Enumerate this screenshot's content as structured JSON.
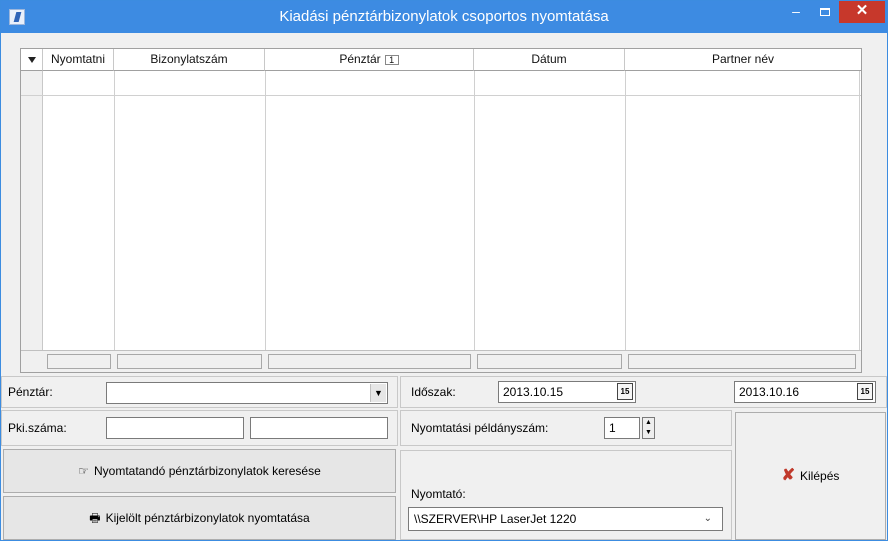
{
  "window": {
    "title": "Kiadási pénztárbizonylatok csoportos nyomtatása",
    "minimize": "–",
    "close": "✕"
  },
  "grid": {
    "columns": [
      "Nyomtatni",
      "Bizonylatszám",
      "Pénztár",
      "Dátum",
      "Partner név"
    ],
    "sort_badge": "1"
  },
  "filters": {
    "penztar_label": "Pénztár:",
    "penztar_value": "",
    "idoszak_label": "Időszak:",
    "date_from": "2013.10.15",
    "date_to": "2013.10.16",
    "calendar_glyph": "15",
    "pki_label": "Pki.száma:",
    "pki_from": "",
    "pki_to": "",
    "copies_label": "Nyomtatási példányszám:",
    "copies_value": "1",
    "printer_label": "Nyomtató:",
    "printer_value": "\\\\SZERVER\\HP LaserJet 1220"
  },
  "buttons": {
    "search": "Nyomtatandó pénztárbizonylatok keresése",
    "print": "Kijelölt pénztárbizonylatok nyomtatása",
    "exit": "Kilépés"
  }
}
